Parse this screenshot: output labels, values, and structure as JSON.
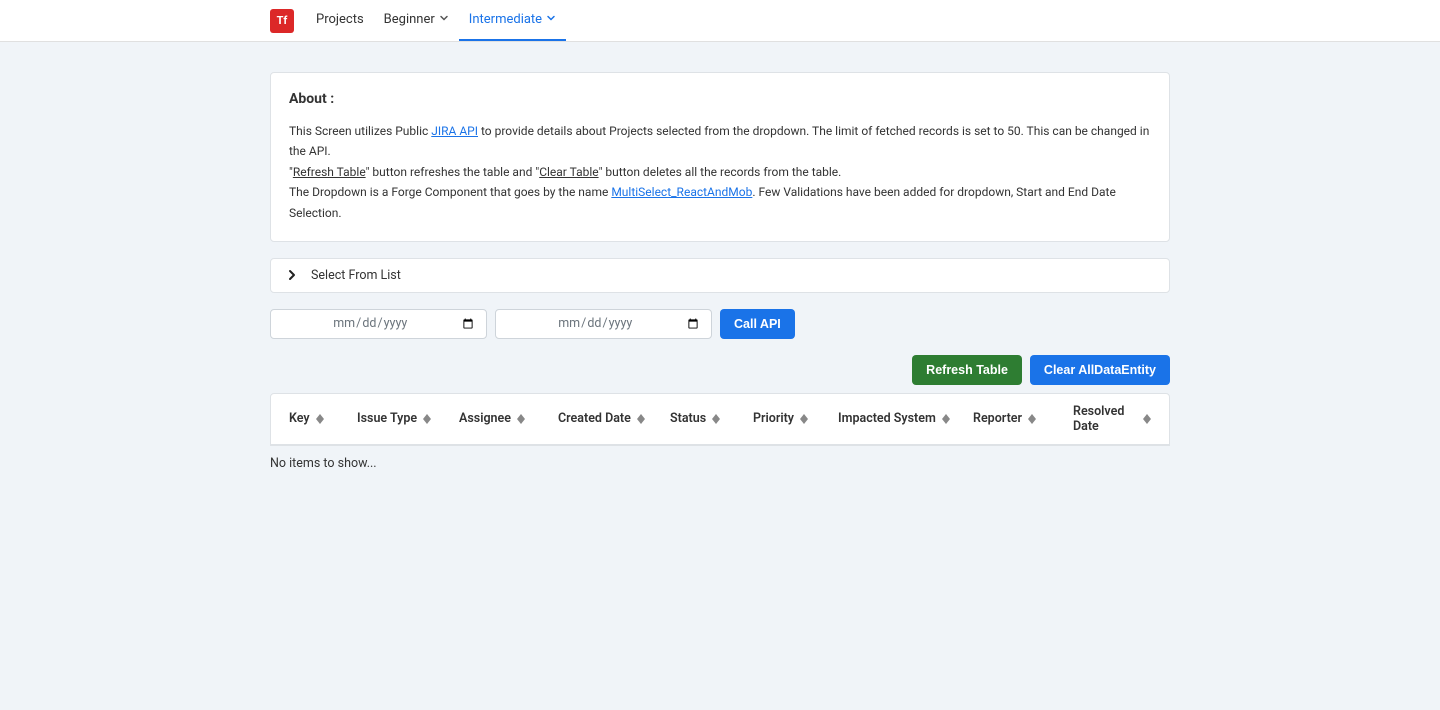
{
  "nav": {
    "logo_text": "Tf",
    "items": [
      {
        "label": "Projects",
        "has_dropdown": false
      },
      {
        "label": "Beginner",
        "has_dropdown": true
      },
      {
        "label": "Intermediate",
        "has_dropdown": true
      }
    ]
  },
  "about": {
    "title": "About :",
    "part1": "This Screen utilizes Public ",
    "link1": "JIRA API",
    "part2": " to provide details about Projects selected from the dropdown. The limit of fetched records is set to 50. This can be changed in the API.",
    "part3a": "\"",
    "udl1": "Refresh Table",
    "part3b": "\" button refreshes the table and \"",
    "udl2": "Clear Table",
    "part3c": "\" button deletes all the records from the table.",
    "part4a": "The Dropdown is a Forge Component that goes by the name ",
    "link2": "MultiSelect_ReactAndMob",
    "part4b": ". Few Validations have been added for dropdown, Start and End Date Selection."
  },
  "select": {
    "label": "Select From List"
  },
  "dates": {
    "placeholder": "mm/dd/yyyy"
  },
  "buttons": {
    "call_api": "Call API",
    "refresh": "Refresh Table",
    "clear": "Clear AllDataEntity"
  },
  "table": {
    "columns": {
      "key": "Key",
      "issue_type": "Issue Type",
      "assignee": "Assignee",
      "created_date": "Created Date",
      "status": "Status",
      "priority": "Priority",
      "impacted_system": "Impacted System",
      "reporter": "Reporter",
      "resolved_date": "Resolved Date"
    },
    "empty": "No items to show..."
  }
}
